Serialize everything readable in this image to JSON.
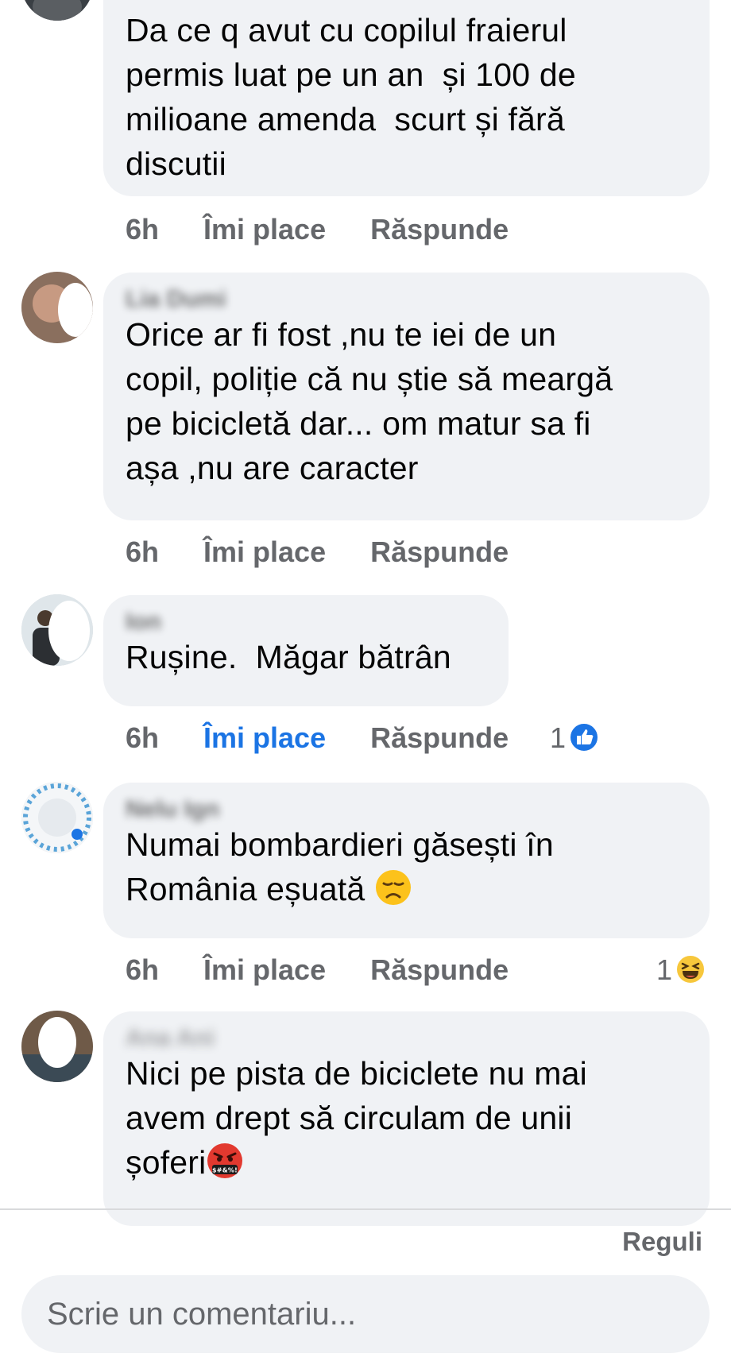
{
  "comments": [
    {
      "author": "",
      "text": "Da ce q avut cu copilul fraierul\npermis luat pe un an  și 100 de\nmilioane amenda  scurt și fără\ndiscutii",
      "time": "6h",
      "like_label": "Îmi place",
      "reply_label": "Răspunde",
      "liked": false
    },
    {
      "author": "Lia Dumi",
      "text": "Orice ar fi fost ,nu te iei de un\ncopil, poliție că nu știe să meargă\npe bicicletă dar... om matur sa fi\nașa ,nu are caracter",
      "time": "6h",
      "like_label": "Îmi place",
      "reply_label": "Răspunde",
      "liked": false
    },
    {
      "author": "Ion",
      "text": "Rușine.  Măgar bătrân",
      "time": "6h",
      "like_label": "Îmi place",
      "reply_label": "Răspunde",
      "liked": true,
      "reaction_count": "1",
      "reaction_icon": "like-reaction-icon"
    },
    {
      "author": "Nelu Ign",
      "text": "Numai bombardieri găsești în\nRomânia eșuată",
      "emoji": "disappointed-face-emoji",
      "time": "6h",
      "like_label": "Îmi place",
      "reply_label": "Răspunde",
      "liked": false,
      "reaction_count": "1",
      "reaction_icon": "haha-reaction-icon"
    },
    {
      "author": "Ana Ani",
      "text": "Nici pe pista de biciclete nu mai\navem drept să circulam de unii\nșoferi",
      "emoji": "cursing-face-emoji"
    }
  ],
  "footer": {
    "rules_label": "Reguli",
    "composer_placeholder": "Scrie un comentariu..."
  },
  "colors": {
    "bubble": "#f0f2f5",
    "meta_text": "#65676b",
    "like_active": "#1b74e4",
    "text": "#050505"
  }
}
